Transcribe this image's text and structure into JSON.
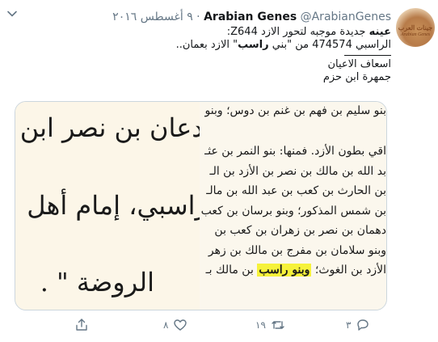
{
  "tweet": {
    "author_name": "Arabian Genes",
    "author_handle": "@ArabianGenes",
    "separator": "·",
    "date": "٩ أغسطس ٢٠١٦",
    "avatar": {
      "logo_text": "جينات العرب",
      "logo_subtext": "Arabian Genes"
    },
    "text": {
      "line1_bold": "عينه",
      "line1_rest": "جديدة موجبه لتحور الازد Z644:",
      "line2_pre": "الراسبي 474574 من \"بني ",
      "line2_bold": "راسب",
      "line2_post": "\" الازد بعمان..",
      "line3": "اسعاف الاعيان",
      "line4": "جمهرة ابن حزم"
    }
  },
  "media": {
    "left_page_lines": [
      "يدعان بن نصر ابن",
      "راسبي، إمام أهل",
      "الروضة \" ."
    ],
    "right_page_lines": [
      "بنو سليم بن فهم بن غنم بن دوس؛ وبنو",
      "اقي بطون الأزد. فمنها: بنو النمر بن عثـ",
      "بد الله بن مالك بن نصر بن الأزد بن الـ",
      "بن الحارث بن كعب بن عبد الله بن مالـ",
      "بن شمس المذكور؛ وبنو برسان بن كعب",
      "دهمان بن نصر بن زهران بن كعب بن",
      "وبنو سلامان بن مفرج بن مالك بن زهر",
      "الأزد بن الغوث؛"
    ],
    "right_page_highlight": "وبنو راسب",
    "right_page_last_post": "بن مالك بـ"
  },
  "actions": {
    "reply_count": "٣",
    "retweet_count": "١٩",
    "like_count": "٨"
  },
  "colors": {
    "secondary_text": "#657786",
    "highlight": "#f6f23a",
    "border": "#ccd6dd"
  }
}
